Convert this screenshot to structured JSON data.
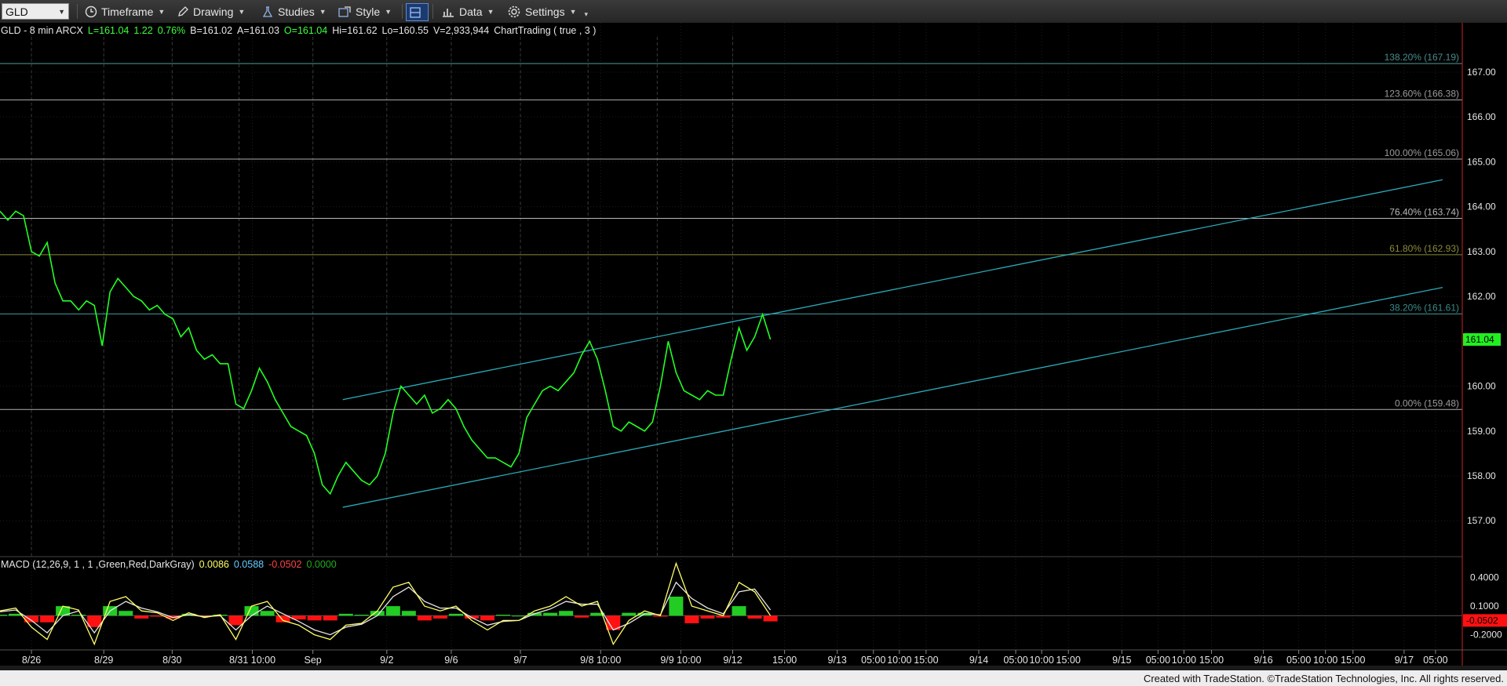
{
  "toolbar": {
    "symbol": "GLD",
    "timeframe_label": "Timeframe",
    "drawing_label": "Drawing",
    "studies_label": "Studies",
    "style_label": "Style",
    "data_label": "Data",
    "settings_label": "Settings"
  },
  "header": {
    "parts": [
      {
        "text": "GLD - 8 min  ARCX",
        "color": "#e6e6e6"
      },
      {
        "text": "L=161.04",
        "color": "#3cff3c"
      },
      {
        "text": "1.22",
        "color": "#3cff3c"
      },
      {
        "text": "0.76%",
        "color": "#3cff3c"
      },
      {
        "text": "B=161.02",
        "color": "#e6e6e6"
      },
      {
        "text": "A=161.03",
        "color": "#e6e6e6"
      },
      {
        "text": "O=161.04",
        "color": "#3cff3c"
      },
      {
        "text": "Hi=161.62",
        "color": "#e6e6e6"
      },
      {
        "text": "Lo=160.55",
        "color": "#e6e6e6"
      },
      {
        "text": "V=2,933,944",
        "color": "#e6e6e6"
      },
      {
        "text": "ChartTrading ( true , 3 )",
        "color": "#e6e6e6"
      }
    ]
  },
  "macd_header": {
    "parts": [
      {
        "text": "MACD (12,26,9, 1 , 1 ,Green,Red,DarkGray)",
        "color": "#e6e6e6"
      },
      {
        "text": "0.0086",
        "color": "#ffff66"
      },
      {
        "text": "0.0588",
        "color": "#66ccff"
      },
      {
        "text": "-0.0502",
        "color": "#ff4444"
      },
      {
        "text": "0.0000",
        "color": "#22aa22"
      }
    ]
  },
  "colors": {
    "price": "#22ff22",
    "channel": "#2aaab8",
    "last_price_bg": "#22ee22",
    "macd_line": "#ffff66",
    "signal_line": "#e6e6e6",
    "hist_pos": "#22cc22",
    "hist_neg": "#ff1111"
  },
  "footer": {
    "text": "Created with TradeStation. ©TradeStation Technologies, Inc. All rights reserved."
  },
  "chart_data": {
    "type": "line",
    "title": "",
    "xlabel": "",
    "ylabel": "",
    "price_axis": {
      "ylim": [
        156.2,
        168.1
      ],
      "ticks": [
        "157.00",
        "158.00",
        "159.00",
        "160.00",
        "161.00",
        "162.00",
        "163.00",
        "164.00",
        "165.00",
        "166.00",
        "167.00"
      ],
      "last_price": 161.04,
      "last_price_label": "161.04"
    },
    "macd_axis": {
      "ylim": [
        -0.36,
        0.62
      ],
      "ticks": [
        {
          "value": 0.4,
          "label": "0.4000"
        },
        {
          "value": 0.1,
          "label": "0.1000"
        },
        {
          "value": -0.2,
          "label": "-0.2000"
        }
      ],
      "last_value": -0.0502,
      "last_value_label": "-0.0502"
    },
    "x_axis": {
      "range": [
        0,
        186
      ],
      "labels": [
        {
          "x": 4,
          "text": "8/26"
        },
        {
          "x": 13.2,
          "text": "8/29"
        },
        {
          "x": 21.9,
          "text": "8/30"
        },
        {
          "x": 31.6,
          "text": "8/31 10:00"
        },
        {
          "x": 39.8,
          "text": "Sep"
        },
        {
          "x": 49.2,
          "text": "9/2"
        },
        {
          "x": 57.4,
          "text": "9/6"
        },
        {
          "x": 66.2,
          "text": "9/7"
        },
        {
          "x": 76.4,
          "text": "9/8 10:00"
        },
        {
          "x": 85.4,
          "text": "9/9 10:00"
        },
        {
          "x": 93.2,
          "text": "9/12"
        },
        {
          "x": 99.8,
          "text": "15:00"
        },
        {
          "x": 106.5,
          "text": "9/13"
        },
        {
          "x": 112.1,
          "text": "05:00"
        },
        {
          "x": 117.8,
          "text": "10:00"
        },
        {
          "x": 117.8,
          "text": ""
        },
        {
          "x": 117.8,
          "text": ""
        }
      ],
      "ticks": [
        {
          "x": 4,
          "text": "8/26"
        },
        {
          "x": 13.2,
          "text": "8/29"
        },
        {
          "x": 21.9,
          "text": "8/30"
        },
        {
          "x": 32.1,
          "text": "8/31 10:00"
        },
        {
          "x": 39.8,
          "text": "Sep"
        },
        {
          "x": 49.2,
          "text": "9/2"
        },
        {
          "x": 57.4,
          "text": "9/6"
        },
        {
          "x": 66.2,
          "text": "9/7"
        },
        {
          "x": 76.4,
          "text": "9/8 10:00"
        },
        {
          "x": 86.6,
          "text": "9/9  10:00"
        },
        {
          "x": 93.2,
          "text": "9/12"
        },
        {
          "x": 99.8,
          "text": "15:00"
        },
        {
          "x": 106.5,
          "text": "9/13"
        },
        {
          "x": 111.1,
          "text": "05:00"
        },
        {
          "x": 114.4,
          "text": "10:00"
        },
        {
          "x": 117.8,
          "text": "15:00"
        },
        {
          "x": 124.5,
          "text": "9/14"
        },
        {
          "x": 129.2,
          "text": "05:00"
        },
        {
          "x": 132.5,
          "text": "10:00"
        },
        {
          "x": 135.9,
          "text": "15:00"
        },
        {
          "x": 142.7,
          "text": "9/15"
        },
        {
          "x": 147.3,
          "text": "05:00"
        },
        {
          "x": 150.6,
          "text": "10:00"
        },
        {
          "x": 154.1,
          "text": "15:00"
        },
        {
          "x": 160.7,
          "text": "9/16"
        },
        {
          "x": 165.2,
          "text": "05:00"
        },
        {
          "x": 168.6,
          "text": "10:00"
        },
        {
          "x": 172.1,
          "text": "15:00"
        },
        {
          "x": 178.6,
          "text": "9/17"
        },
        {
          "x": 182.6,
          "text": "05:00"
        }
      ],
      "session_lines": [
        4,
        13.2,
        21.9,
        30.4,
        39.8,
        49.2,
        57.4,
        66.2,
        74.8,
        83.6,
        93.2
      ]
    },
    "series": [
      {
        "kind": "price",
        "x": [
          0,
          1,
          2,
          3,
          4,
          5,
          6,
          7,
          8,
          9,
          10,
          11,
          12,
          13,
          14,
          15,
          16,
          17,
          18,
          19,
          20,
          21,
          22,
          23,
          24,
          25,
          26,
          27,
          28,
          29,
          30,
          31,
          32,
          33,
          34,
          35,
          36,
          37,
          38,
          39,
          40,
          41,
          42,
          43,
          44,
          45,
          46,
          47,
          48,
          49,
          50,
          51,
          52,
          53,
          54,
          55,
          56,
          57,
          58,
          59,
          60,
          61,
          62,
          63,
          64,
          65,
          66,
          67,
          68,
          69,
          70,
          71,
          72,
          73,
          74,
          75,
          76,
          77,
          78,
          79,
          80,
          81,
          82,
          83,
          84,
          85,
          86,
          87,
          88,
          89,
          90,
          91,
          92,
          93,
          94,
          95,
          96,
          97,
          98
        ],
        "y": [
          163.9,
          163.7,
          163.9,
          163.8,
          163.0,
          162.9,
          163.2,
          162.3,
          161.9,
          161.9,
          161.7,
          161.9,
          161.8,
          160.9,
          162.1,
          162.4,
          162.2,
          162.0,
          161.9,
          161.7,
          161.8,
          161.6,
          161.5,
          161.1,
          161.3,
          160.8,
          160.6,
          160.7,
          160.5,
          160.5,
          159.6,
          159.5,
          159.9,
          160.4,
          160.1,
          159.7,
          159.4,
          159.1,
          159.0,
          158.9,
          158.5,
          157.8,
          157.6,
          158.0,
          158.3,
          158.1,
          157.9,
          157.8,
          158.0,
          158.5,
          159.4,
          160.0,
          159.8,
          159.6,
          159.8,
          159.4,
          159.5,
          159.7,
          159.5,
          159.1,
          158.8,
          158.6,
          158.4,
          158.4,
          158.3,
          158.2,
          158.5,
          159.3,
          159.6,
          159.9,
          160.0,
          159.9,
          160.1,
          160.3,
          160.7,
          161.0,
          160.6,
          159.9,
          159.1,
          159.0,
          159.2,
          159.1,
          159.0,
          159.2,
          160.0,
          161.0,
          160.3,
          159.9,
          159.8,
          159.7,
          159.9,
          159.8,
          159.8,
          160.6,
          161.3,
          160.8,
          161.1,
          161.6,
          161.04
        ]
      },
      {
        "kind": "macd",
        "x": [
          0,
          2,
          4,
          6,
          8,
          10,
          12,
          14,
          16,
          18,
          20,
          22,
          24,
          26,
          28,
          30,
          32,
          34,
          36,
          38,
          40,
          42,
          44,
          46,
          48,
          50,
          52,
          54,
          56,
          58,
          60,
          62,
          64,
          66,
          68,
          70,
          72,
          74,
          76,
          78,
          80,
          82,
          84,
          86,
          88,
          90,
          92,
          94,
          96,
          98
        ],
        "y": [
          0.05,
          0.08,
          -0.12,
          -0.25,
          0.1,
          0.06,
          -0.3,
          0.15,
          0.2,
          0.05,
          0.03,
          -0.05,
          0.03,
          -0.02,
          0.01,
          -0.25,
          0.1,
          0.15,
          -0.05,
          -0.1,
          -0.2,
          -0.25,
          -0.1,
          -0.08,
          0.05,
          0.3,
          0.35,
          0.1,
          0.05,
          0.1,
          -0.05,
          -0.15,
          -0.05,
          -0.05,
          0.05,
          0.1,
          0.2,
          0.1,
          0.15,
          -0.3,
          -0.05,
          0.05,
          0.0,
          0.55,
          0.1,
          0.05,
          0.0,
          0.35,
          0.25,
          0.0
        ]
      },
      {
        "kind": "signal",
        "x": [
          0,
          2,
          4,
          6,
          8,
          10,
          12,
          14,
          16,
          18,
          20,
          22,
          24,
          26,
          28,
          30,
          32,
          34,
          36,
          38,
          40,
          42,
          44,
          46,
          48,
          50,
          52,
          54,
          56,
          58,
          60,
          62,
          64,
          66,
          68,
          70,
          72,
          74,
          76,
          78,
          80,
          82,
          84,
          86,
          88,
          90,
          92,
          94,
          96,
          98
        ],
        "y": [
          0.04,
          0.06,
          -0.05,
          -0.18,
          0.0,
          0.05,
          -0.18,
          0.05,
          0.15,
          0.08,
          0.04,
          -0.02,
          0.01,
          -0.01,
          0.0,
          -0.15,
          0.0,
          0.1,
          0.02,
          -0.06,
          -0.15,
          -0.2,
          -0.12,
          -0.09,
          0.0,
          0.2,
          0.3,
          0.15,
          0.08,
          0.08,
          -0.02,
          -0.1,
          -0.06,
          -0.05,
          0.02,
          0.07,
          0.15,
          0.12,
          0.12,
          -0.15,
          -0.08,
          0.02,
          0.01,
          0.35,
          0.18,
          0.08,
          0.02,
          0.25,
          0.28,
          0.06
        ]
      }
    ],
    "fib_levels": [
      {
        "price": 167.19,
        "label": "138.20% (167.19)",
        "color": "#4a8a8a"
      },
      {
        "price": 166.38,
        "label": "123.60% (166.38)",
        "color": "#9a9a9a"
      },
      {
        "price": 165.06,
        "label": "100.00% (165.06)",
        "color": "#9a9a9a"
      },
      {
        "price": 163.74,
        "label": "76.40% (163.74)",
        "color": "#b8b8b8"
      },
      {
        "price": 162.93,
        "label": "61.80% (162.93)",
        "color": "#8a8a3a"
      },
      {
        "price": 161.61,
        "label": "38.20% (161.61)",
        "color": "#3a8a8a"
      },
      {
        "price": 159.48,
        "label": "0.00% (159.48)",
        "color": "#9a9a9a"
      }
    ],
    "channel_lines": [
      {
        "x1": 43.6,
        "y1": 159.7,
        "x2": 183.5,
        "y2": 164.6
      },
      {
        "x1": 43.6,
        "y1": 157.3,
        "x2": 183.5,
        "y2": 162.2
      }
    ]
  }
}
